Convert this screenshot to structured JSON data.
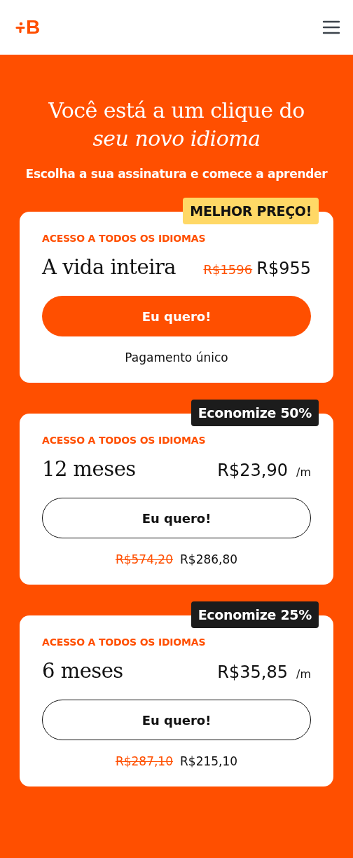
{
  "header": {
    "logo": "B"
  },
  "hero": {
    "title": "Você está a um clique do *seu novo idioma*",
    "subtitle": "Escolha a sua assinatura e comece a aprender"
  },
  "plans": [
    {
      "kind": "lifetime",
      "badge": {
        "text": "MELHOR PREÇO!",
        "color": "#ffd866"
      },
      "label": "ACESSO A TODOS OS IDIOMAS",
      "name": "A vida inteira",
      "old_price": "R$1596",
      "price": "R$955",
      "button": "Eu quero!",
      "note": "Pagamento único"
    },
    {
      "kind": "monthly",
      "badge": {
        "text": "Economize 50%",
        "color": "#1c1c1c"
      },
      "label": "ACESSO A TODOS OS IDIOMAS",
      "name": "12 meses",
      "price": "R$23,90",
      "unit": "/m",
      "button": "Eu quero!",
      "old_total": "R$574,20",
      "total": "R$286,80"
    },
    {
      "kind": "monthly",
      "badge": {
        "text": "Economize 25%",
        "color": "#1c1c1c"
      },
      "label": "ACESSO A TODOS OS IDIOMAS",
      "name": "6 meses",
      "price": "R$35,85",
      "unit": "/m",
      "button": "Eu quero!",
      "old_total": "R$287,10",
      "total": "R$215,10"
    }
  ]
}
